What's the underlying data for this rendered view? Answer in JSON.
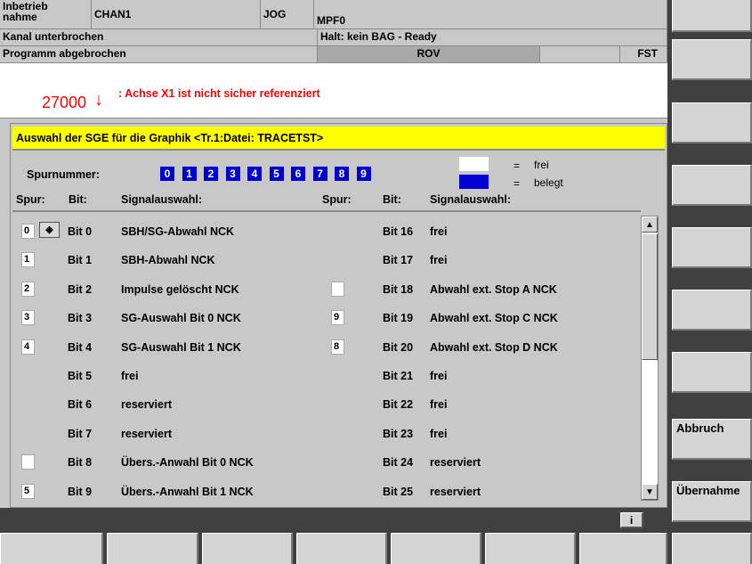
{
  "header": {
    "area": "Inbetrieb\nnahme",
    "channel": "CHAN1",
    "mode": "JOG",
    "program": "MPF0",
    "channel_status": "Kanal unterbrochen",
    "stop_status": "Halt: kein BAG - Ready",
    "program_status": "Programm abgebrochen",
    "rov": "ROV",
    "fst": "FST"
  },
  "alarm": {
    "number": "27000",
    "text": ": Achse X1 ist nicht sicher referenziert"
  },
  "dialog": {
    "title": "Auswahl der SGE für die Graphik <Tr.1:Datei: TRACETST>",
    "spurnummer_label": "Spurnummer:",
    "spurnummern": [
      "0",
      "1",
      "2",
      "3",
      "4",
      "5",
      "6",
      "7",
      "8",
      "9"
    ],
    "legend_free": "frei",
    "legend_used": "belegt",
    "legend_eq": "=",
    "col_spur": "Spur:",
    "col_bit": "Bit:",
    "col_signal": "Signalauswahl:",
    "rows": [
      {
        "l_spur": "0",
        "l_bit": "Bit  0",
        "l_sig": "SBH/SG-Abwahl NCK",
        "r_spur": "",
        "r_bit": "Bit 16",
        "r_sig": "frei"
      },
      {
        "l_spur": "1",
        "l_bit": "Bit  1",
        "l_sig": "SBH-Abwahl NCK",
        "r_spur": "",
        "r_bit": "Bit 17",
        "r_sig": "frei"
      },
      {
        "l_spur": "2",
        "l_bit": "Bit  2",
        "l_sig": "Impulse gelöscht NCK",
        "r_spur": "",
        "r_bit": "Bit 18",
        "r_sig": "Abwahl ext. Stop A NCK"
      },
      {
        "l_spur": "3",
        "l_bit": "Bit  3",
        "l_sig": "SG-Auswahl Bit 0 NCK",
        "r_spur": "9",
        "r_bit": "Bit 19",
        "r_sig": "Abwahl ext. Stop C NCK"
      },
      {
        "l_spur": "4",
        "l_bit": "Bit  4",
        "l_sig": "SG-Auswahl Bit 1 NCK",
        "r_spur": "8",
        "r_bit": "Bit 20",
        "r_sig": "Abwahl ext. Stop D NCK"
      },
      {
        "l_spur": "",
        "l_bit": "Bit  5",
        "l_sig": "frei",
        "r_spur": "",
        "r_bit": "Bit 21",
        "r_sig": "frei"
      },
      {
        "l_spur": "",
        "l_bit": "Bit  6",
        "l_sig": "reserviert",
        "r_spur": "",
        "r_bit": "Bit 22",
        "r_sig": "frei"
      },
      {
        "l_spur": "",
        "l_bit": "Bit  7",
        "l_sig": "reserviert",
        "r_spur": "",
        "r_bit": "Bit 23",
        "r_sig": "frei"
      },
      {
        "l_spur": "",
        "l_bit": "Bit  8",
        "l_sig": "Übers.-Anwahl Bit 0 NCK",
        "r_spur": "",
        "r_bit": "Bit 24",
        "r_sig": "reserviert"
      },
      {
        "l_spur": "5",
        "l_bit": "Bit  9",
        "l_sig": "Übers.-Anwahl Bit 1 NCK",
        "r_spur": "",
        "r_bit": "Bit 25",
        "r_sig": "reserviert"
      }
    ]
  },
  "softkeys": {
    "abbruch": "Abbruch",
    "uebernahme": "Übernahme",
    "info": "i"
  },
  "colors": {
    "title_bar": "#ffff00",
    "used_blue": "#0000d0",
    "alarm_red": "#ff0000"
  }
}
